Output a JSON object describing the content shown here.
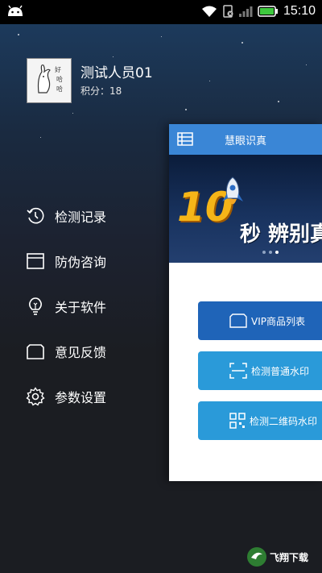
{
  "status_bar": {
    "time": "15:10"
  },
  "profile": {
    "username": "测试人员01",
    "points": "积分：18",
    "avatar_text": "好哈哈"
  },
  "menu": {
    "items": [
      {
        "label": "检测记录",
        "icon": "history-icon"
      },
      {
        "label": "防伪咨询",
        "icon": "window-icon"
      },
      {
        "label": "关于软件",
        "icon": "bulb-icon"
      },
      {
        "label": "意见反馈",
        "icon": "folder-icon"
      },
      {
        "label": "参数设置",
        "icon": "gear-icon"
      }
    ]
  },
  "main": {
    "title": "慧眼识真",
    "banner": {
      "big_number": "10",
      "text": "秒 辨别真"
    },
    "buttons": [
      {
        "label": "VIP商品列表"
      },
      {
        "label": "检测普通水印"
      },
      {
        "label": "检测二维码水印"
      }
    ]
  },
  "watermark": {
    "text": "飞翔下载"
  },
  "colors": {
    "header_blue": "#3a86d6",
    "vip_button": "#1f64b8",
    "button_blue": "#2a9ad9",
    "banner_yellow": "#f5b518"
  }
}
